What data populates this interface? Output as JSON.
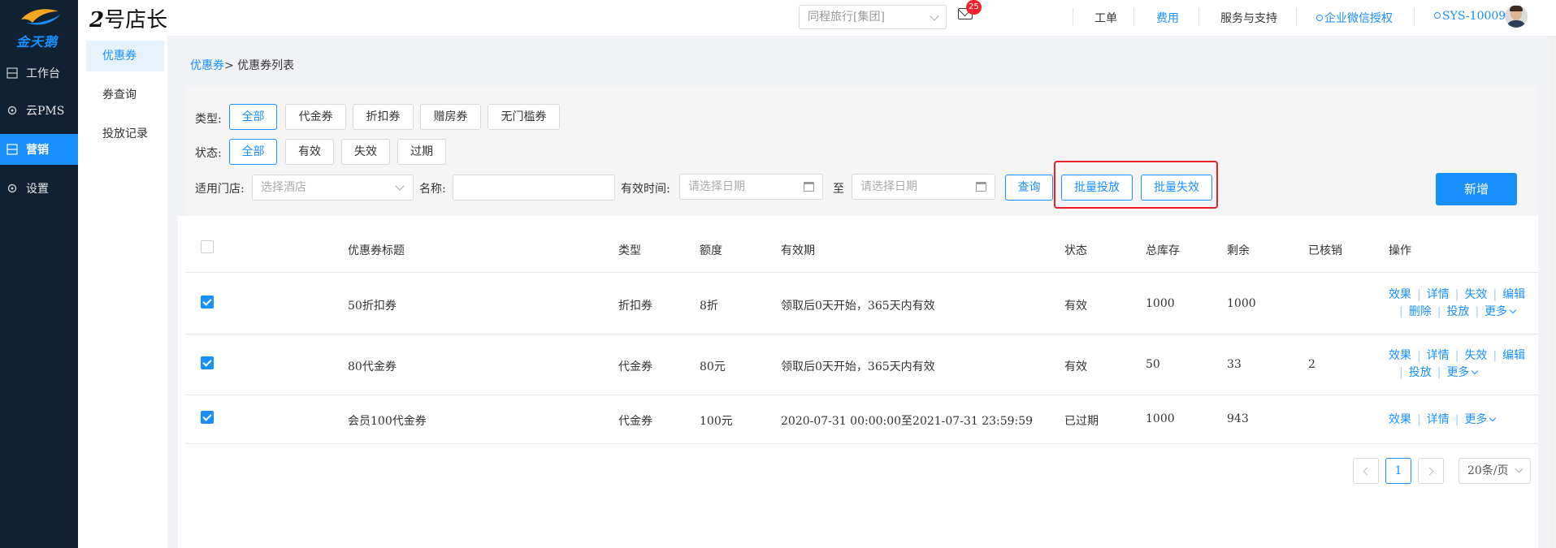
{
  "brand": {
    "logo_text": "金天鹅",
    "app_title_num": "2",
    "app_title_text": "号店长"
  },
  "leftnav": [
    {
      "label": "工作台",
      "icon": "workbench-icon"
    },
    {
      "label": "云PMS",
      "icon": "gear-icon"
    },
    {
      "label": "营销",
      "icon": "marketing-icon",
      "active": true
    },
    {
      "label": "设置",
      "icon": "gear-icon"
    }
  ],
  "subnav": [
    {
      "label": "优惠券",
      "active": true
    },
    {
      "label": "券查询"
    },
    {
      "label": "投放记录"
    }
  ],
  "header": {
    "org_select": "同程旅行[集团]",
    "mail_badge": "25",
    "links": [
      "工单",
      "费用",
      "服务与支持",
      "企业微信授权",
      "SYS-10009"
    ]
  },
  "breadcrumb": {
    "root": "优惠券",
    "sep": ">",
    "current": " 优惠券列表"
  },
  "filters": {
    "type_label": "类型:",
    "types": [
      "全部",
      "代金券",
      "折扣券",
      "赠房券",
      "无门槛券"
    ],
    "status_label": "状态:",
    "statuses": [
      "全部",
      "有效",
      "失效",
      "过期"
    ],
    "store_label": "适用门店:",
    "store_placeholder": "选择酒店",
    "name_label": "名称:",
    "name_value": "",
    "time_label": "有效时间:",
    "date_placeholder": "请选择日期",
    "to_label": "至",
    "query": "查询",
    "batch_issue": "批量投放",
    "batch_invalidate": "批量失效",
    "add": "新增"
  },
  "table": {
    "columns": [
      "优惠券标题",
      "类型",
      "额度",
      "有效期",
      "状态",
      "总库存",
      "剩余",
      "已核销",
      "操作"
    ],
    "rows": [
      {
        "checked": true,
        "title": "50折扣券",
        "type": "折扣券",
        "amount": "8折",
        "validity": "领取后0天开始，365天内有效",
        "status": "有效",
        "stock": "1000",
        "remain": "1000",
        "used": "",
        "ops1": [
          "效果",
          "详情",
          "失效",
          "编辑"
        ],
        "ops2": [
          "删除",
          "投放",
          "更多"
        ]
      },
      {
        "checked": true,
        "title": "80代金券",
        "type": "代金券",
        "amount": "80元",
        "validity": "领取后0天开始，365天内有效",
        "status": "有效",
        "stock": "50",
        "remain": "33",
        "used": "2",
        "ops1": [
          "效果",
          "详情",
          "失效",
          "编辑"
        ],
        "ops2": [
          "投放",
          "更多"
        ]
      },
      {
        "checked": true,
        "title": "会员100代金券",
        "type": "代金券",
        "amount": "100元",
        "validity": "2020-07-31 00:00:00至2021-07-31 23:59:59",
        "status": "已过期",
        "stock": "1000",
        "remain": "943",
        "used": "",
        "ops1": [
          "效果",
          "详情",
          "更多"
        ],
        "ops2": []
      }
    ]
  },
  "pagination": {
    "current": "1",
    "page_size": "20条/页"
  },
  "colors": {
    "accent": "#1890ff",
    "nav_bg": "#0f2133",
    "highlight": "#e8202a",
    "badge": "#f5222d"
  }
}
